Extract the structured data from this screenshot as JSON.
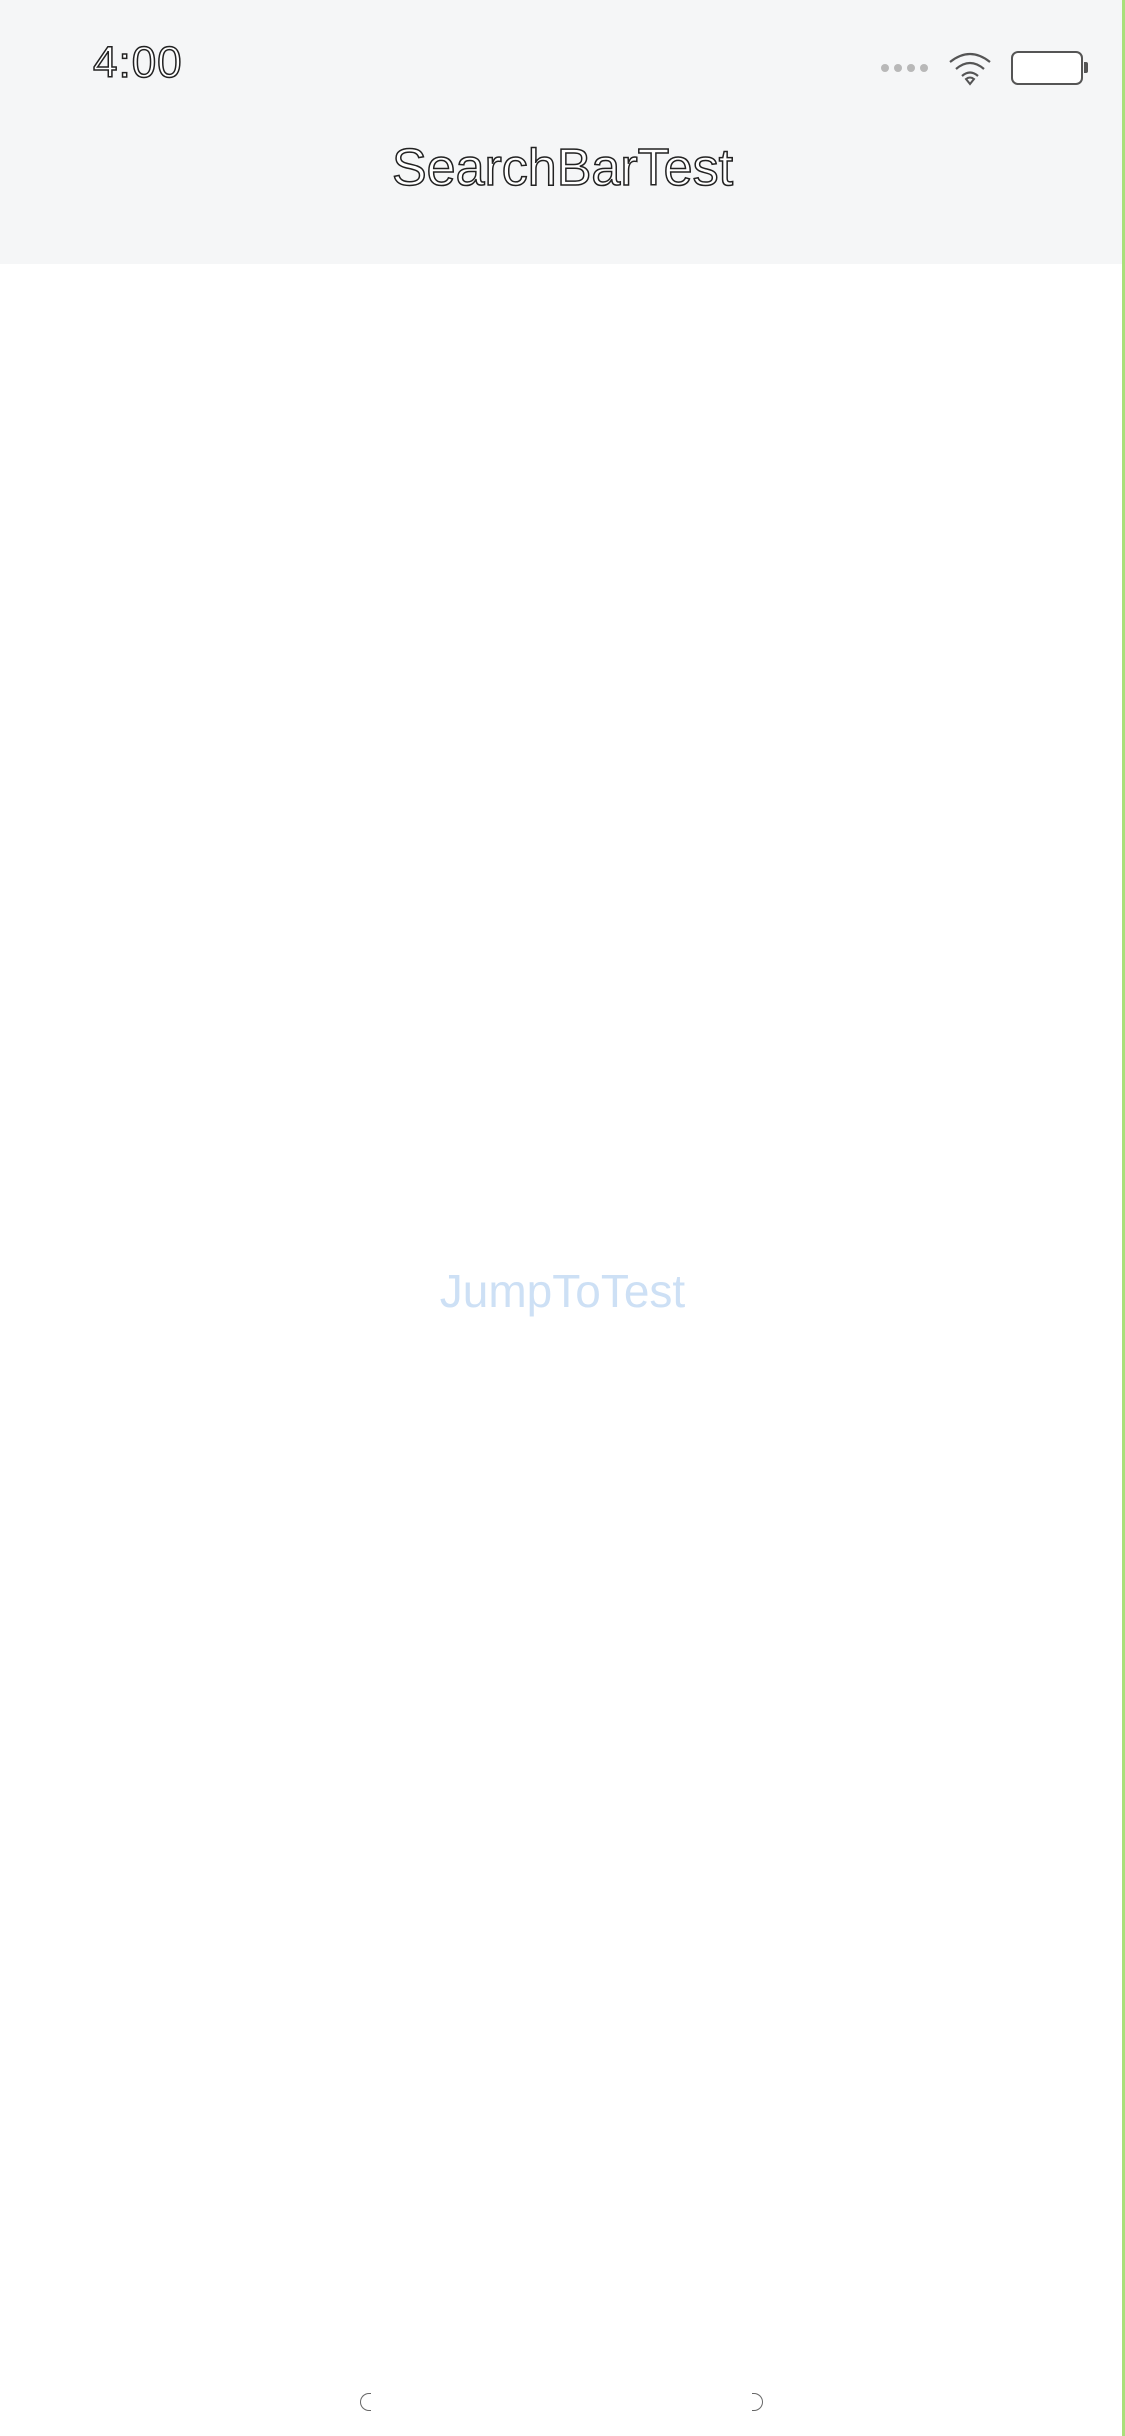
{
  "status_bar": {
    "time": "4:00",
    "icons": [
      "signal-dots-icon",
      "wifi-icon",
      "battery-icon"
    ]
  },
  "nav_bar": {
    "title": "SearchBarTest"
  },
  "main": {
    "jump_button_label": "JumpToTest"
  },
  "colors": {
    "top_background": "#f5f6f7",
    "content_background": "#ffffff",
    "button_text": "#cde0f5",
    "right_edge": "#a8e07a"
  }
}
